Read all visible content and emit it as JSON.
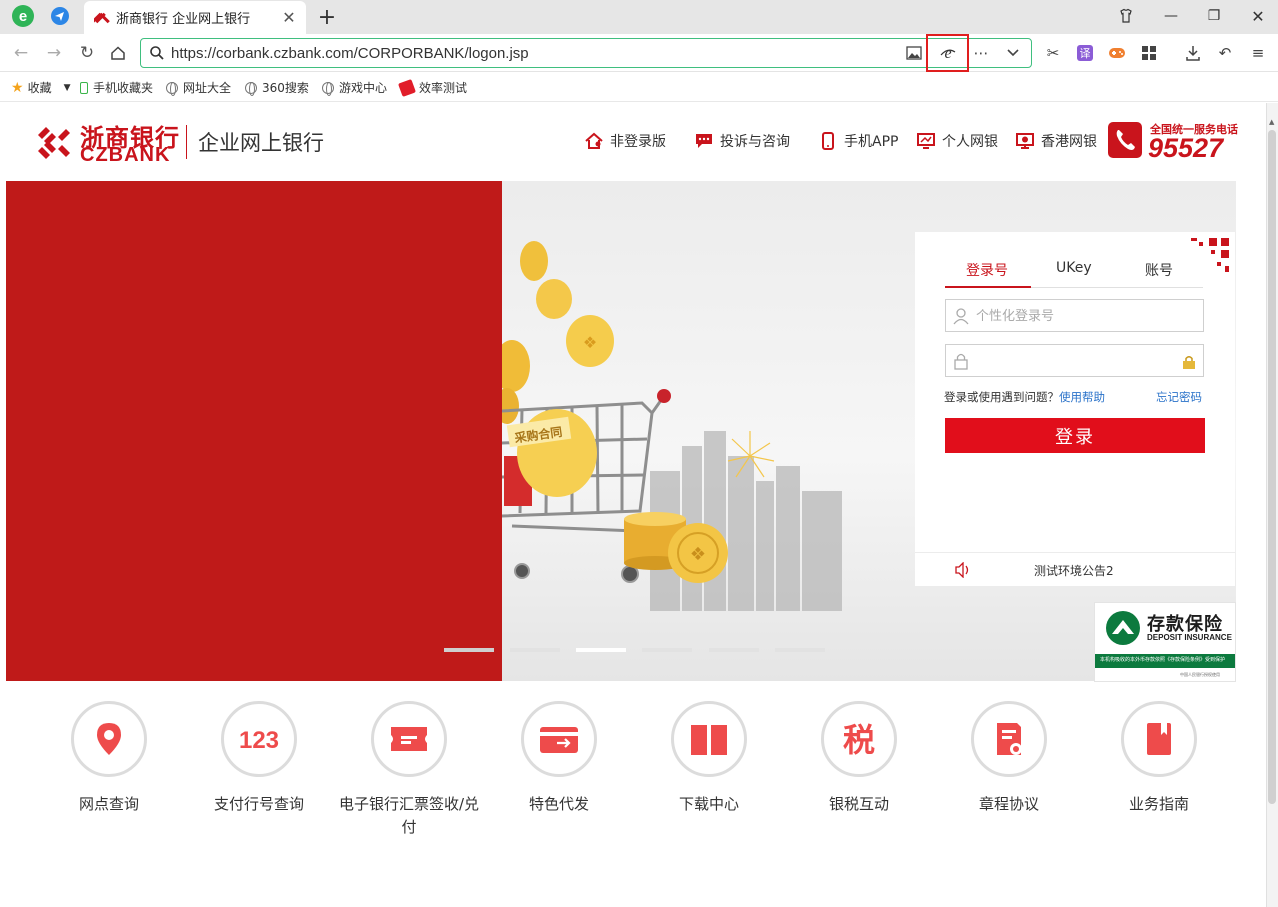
{
  "browser": {
    "tab_title": "浙商银行 企业网上银行",
    "url": "https://corbank.czbank.com/CORPORBANK/logon.jsp",
    "bookmarks": [
      {
        "label": "收藏",
        "icon": "star-icon"
      },
      {
        "label": "手机收藏夹",
        "icon": "phone-icon"
      },
      {
        "label": "网址大全",
        "icon": "globe-icon"
      },
      {
        "label": "360搜索",
        "icon": "globe-icon"
      },
      {
        "label": "游戏中心",
        "icon": "globe-icon"
      },
      {
        "label": "效率测试",
        "icon": "red-tag-icon"
      }
    ],
    "ie_mode_highlighted": true
  },
  "bank": {
    "logo_cn": "浙商银行",
    "logo_en": "CZBANK",
    "site_title": "企业网上银行",
    "nav": [
      {
        "label": "非登录版",
        "icon": "home-icon"
      },
      {
        "label": "投诉与咨询",
        "icon": "chat-icon"
      },
      {
        "label": "手机APP",
        "icon": "mobile-icon"
      },
      {
        "label": "个人网银",
        "icon": "monitor-icon"
      },
      {
        "label": "香港网银",
        "icon": "hk-monitor-icon"
      }
    ],
    "hotline_label": "全国统一服务电话",
    "hotline_number": "95527",
    "accent": "#c9141c"
  },
  "hero": {
    "cart_label": "采购合同",
    "dots_count": 6,
    "active_dot": 3
  },
  "login": {
    "tabs": [
      "登录号",
      "UKey",
      "账号"
    ],
    "active_tab": 0,
    "username_placeholder": "个性化登录号",
    "help_prefix": "登录或使用遇到问题？",
    "help_link": "使用帮助",
    "forgot_link": "忘记密码",
    "submit_label": "登录",
    "notice": "测试环境公告2",
    "button_color": "#e10e1b"
  },
  "deposit": {
    "title": "存款保险",
    "subtitle": "DEPOSIT INSURANCE",
    "band": "本机构吸收的本外币存款依照《存款保险条例》受到保护",
    "footer": "中国人民银行授权使用"
  },
  "services": [
    {
      "label": "网点查询",
      "icon": "location-pin-icon"
    },
    {
      "label": "支付行号查询",
      "icon": "number-123-icon"
    },
    {
      "label": "电子银行汇票签收/兑付",
      "icon": "ticket-icon"
    },
    {
      "label": "特色代发",
      "icon": "card-transfer-icon"
    },
    {
      "label": "下载中心",
      "icon": "book-icon"
    },
    {
      "label": "银税互动",
      "icon": "tax-icon"
    },
    {
      "label": "章程协议",
      "icon": "document-icon"
    },
    {
      "label": "业务指南",
      "icon": "bookmark-book-icon"
    }
  ]
}
